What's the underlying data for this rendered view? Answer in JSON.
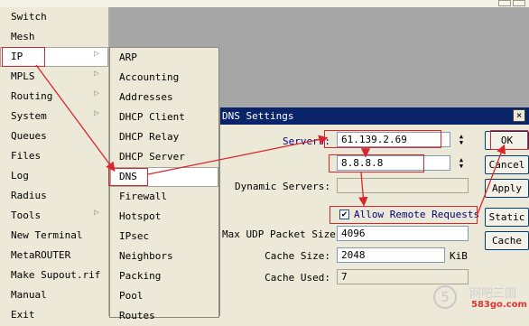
{
  "window": {
    "title": ""
  },
  "left_menu": {
    "items": [
      {
        "label": "Switch",
        "has_submenu": false
      },
      {
        "label": "Mesh",
        "has_submenu": false
      },
      {
        "label": "IP",
        "has_submenu": true,
        "selected": true
      },
      {
        "label": "MPLS",
        "has_submenu": true
      },
      {
        "label": "Routing",
        "has_submenu": true
      },
      {
        "label": "System",
        "has_submenu": true
      },
      {
        "label": "Queues",
        "has_submenu": false
      },
      {
        "label": "Files",
        "has_submenu": false
      },
      {
        "label": "Log",
        "has_submenu": false
      },
      {
        "label": "Radius",
        "has_submenu": false
      },
      {
        "label": "Tools",
        "has_submenu": true
      },
      {
        "label": "New Terminal",
        "has_submenu": false
      },
      {
        "label": "MetaROUTER",
        "has_submenu": false
      },
      {
        "label": "Make Supout.rif",
        "has_submenu": false
      },
      {
        "label": "Manual",
        "has_submenu": false
      },
      {
        "label": "Exit",
        "has_submenu": false
      }
    ]
  },
  "ip_submenu": {
    "items": [
      {
        "label": "ARP"
      },
      {
        "label": "Accounting"
      },
      {
        "label": "Addresses"
      },
      {
        "label": "DHCP Client"
      },
      {
        "label": "DHCP Relay"
      },
      {
        "label": "DHCP Server"
      },
      {
        "label": "DNS",
        "selected": true
      },
      {
        "label": "Firewall"
      },
      {
        "label": "Hotspot"
      },
      {
        "label": "IPsec"
      },
      {
        "label": "Neighbors"
      },
      {
        "label": "Packing"
      },
      {
        "label": "Pool"
      },
      {
        "label": "Routes"
      }
    ]
  },
  "dns_dialog": {
    "title": "DNS Settings",
    "close_glyph": "×",
    "servers_label": "Servers:",
    "server1": "61.139.2.69",
    "server2": "8.8.8.8",
    "dynamic_servers_label": "Dynamic Servers:",
    "dynamic_servers_value": "",
    "allow_remote_label": "Allow Remote Requests",
    "allow_remote_checked": true,
    "check_glyph": "✔",
    "max_udp_label": "Max UDP Packet Size:",
    "max_udp_value": "4096",
    "cache_size_label": "Cache Size:",
    "cache_size_value": "2048",
    "cache_size_unit": "KiB",
    "cache_used_label": "Cache Used:",
    "cache_used_value": "7",
    "buttons": {
      "ok": "OK",
      "cancel": "Cancel",
      "apply": "Apply",
      "static": "Static",
      "cache": "Cache"
    }
  },
  "annotations": {
    "color": "#d9262c"
  },
  "watermark": {
    "number": "5",
    "cn_text": "网吧三国",
    "site": "583go.com"
  },
  "colors": {
    "title_bar": "#0a246a",
    "right_panel": "#a6a6a6",
    "menu_bg": "#ece9d8"
  }
}
